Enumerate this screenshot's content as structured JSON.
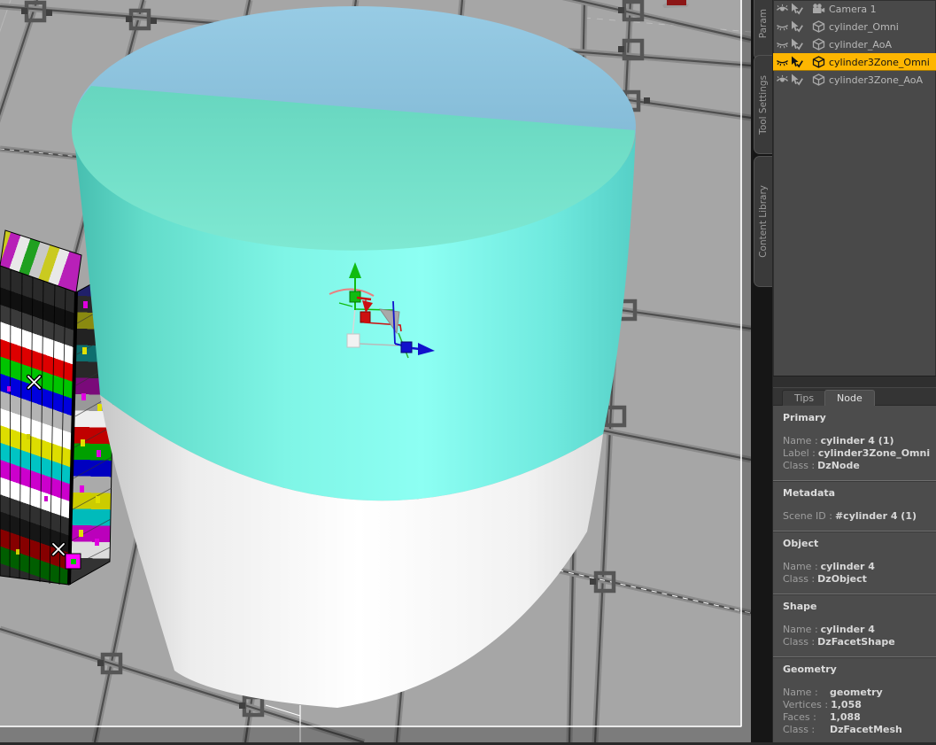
{
  "app": {
    "description": "3D modeling viewport with scene tree and node properties panel"
  },
  "colors": {
    "selection_highlight": "#feb601",
    "panel_background": "#4c4c4c",
    "floor": "#a6a6a6",
    "cylinder_side_cyan": "#7df2e4",
    "cylinder_cap_back_blue": "#8fc3dd",
    "cylinder_cap_front_teal": "#72dcc6",
    "cylinder_bottom_white": "#ffffff",
    "axis_x_red": "#cc1111",
    "axis_y_green": "#11bb11",
    "axis_z_blue": "#1111cc"
  },
  "scene_tree": {
    "items": [
      {
        "label": "Camera 1",
        "icon": "camera",
        "eye": "open",
        "selected": false
      },
      {
        "label": "cylinder_Omni",
        "icon": "cube",
        "eye": "closed",
        "selected": false
      },
      {
        "label": "cylinder_AoA",
        "icon": "cube",
        "eye": "closed",
        "selected": false
      },
      {
        "label": "cylinder3Zone_Omni",
        "icon": "cube",
        "eye": "closed",
        "selected": true
      },
      {
        "label": "cylinder3Zone_AoA",
        "icon": "cube",
        "eye": "open",
        "selected": false
      }
    ]
  },
  "side_tabs": {
    "parameters": "Param",
    "tool_settings": "Tool Settings",
    "content_library": "Content Library"
  },
  "bottom_tabs": {
    "tips": "Tips",
    "node": "Node",
    "active": "Node"
  },
  "node_panel": {
    "primary": {
      "title": "Primary",
      "rows": [
        {
          "label": "Name :",
          "value": "cylinder 4 (1)"
        },
        {
          "label": "Label :",
          "value": "cylinder3Zone_Omni"
        },
        {
          "label": "Class :",
          "value": "DzNode"
        }
      ]
    },
    "metadata": {
      "title": "Metadata",
      "rows": [
        {
          "label": "Scene ID :",
          "value": "#cylinder 4 (1)"
        }
      ]
    },
    "object": {
      "title": "Object",
      "rows": [
        {
          "label": "Name :",
          "value": "cylinder 4"
        },
        {
          "label": "Class :",
          "value": "DzObject"
        }
      ]
    },
    "shape": {
      "title": "Shape",
      "rows": [
        {
          "label": "Name :",
          "value": "cylinder 4"
        },
        {
          "label": "Class :",
          "value": "DzFacetShape"
        }
      ]
    },
    "geometry": {
      "title": "Geometry",
      "rows": [
        {
          "label": "Name :",
          "value": "geometry"
        },
        {
          "label": "Vertices :",
          "value": "1,058"
        },
        {
          "label": "Faces :",
          "value": "1,088"
        },
        {
          "label": "Class :",
          "value": "DzFacetMesh"
        }
      ]
    }
  }
}
